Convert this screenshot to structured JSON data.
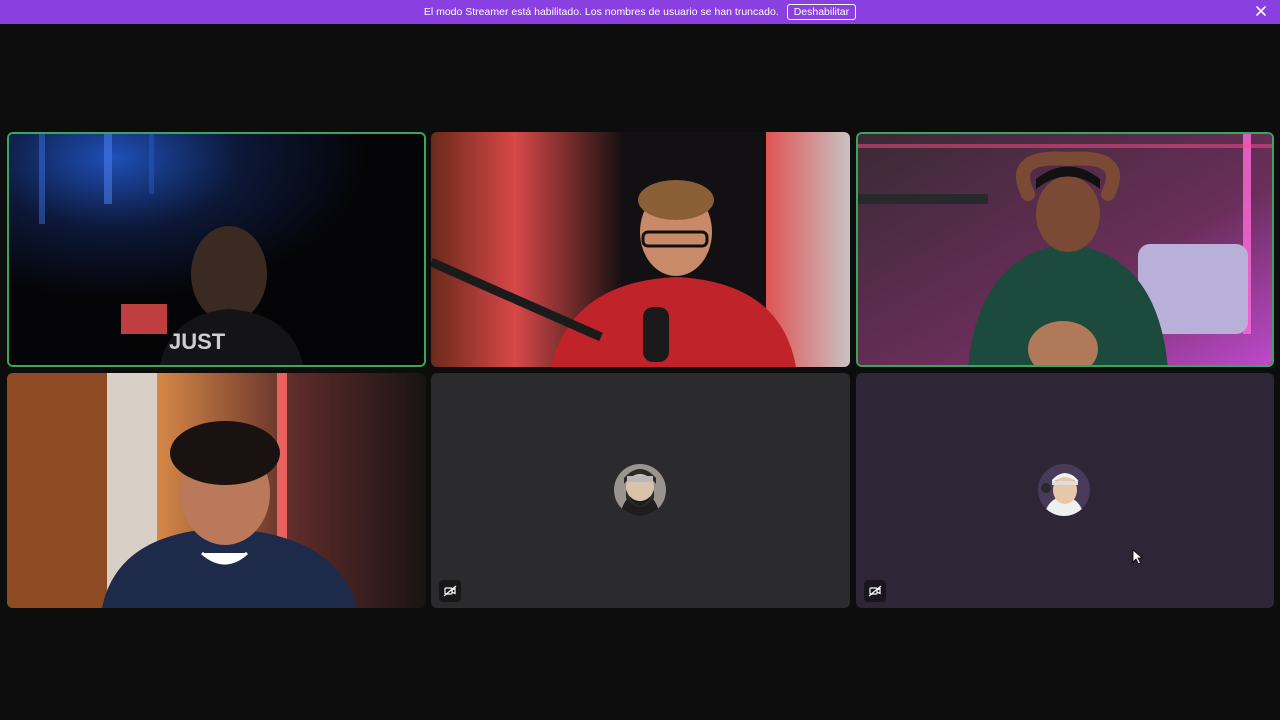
{
  "banner": {
    "message": "El modo Streamer está habilitado. Los nombres de usuario se han truncado.",
    "disable_label": "Deshabilitar",
    "close_icon": "close-icon",
    "color": "#8a3fe0"
  },
  "call": {
    "speaking_color": "#3ba55d",
    "tiles": [
      {
        "type": "video",
        "speaking": true
      },
      {
        "type": "video",
        "speaking": false
      },
      {
        "type": "video",
        "speaking": true
      },
      {
        "type": "video",
        "speaking": false
      },
      {
        "type": "avatar",
        "speaking": false,
        "camera_off_icon": "camera-off-icon"
      },
      {
        "type": "avatar",
        "speaking": false,
        "camera_off_icon": "camera-off-icon"
      }
    ]
  }
}
